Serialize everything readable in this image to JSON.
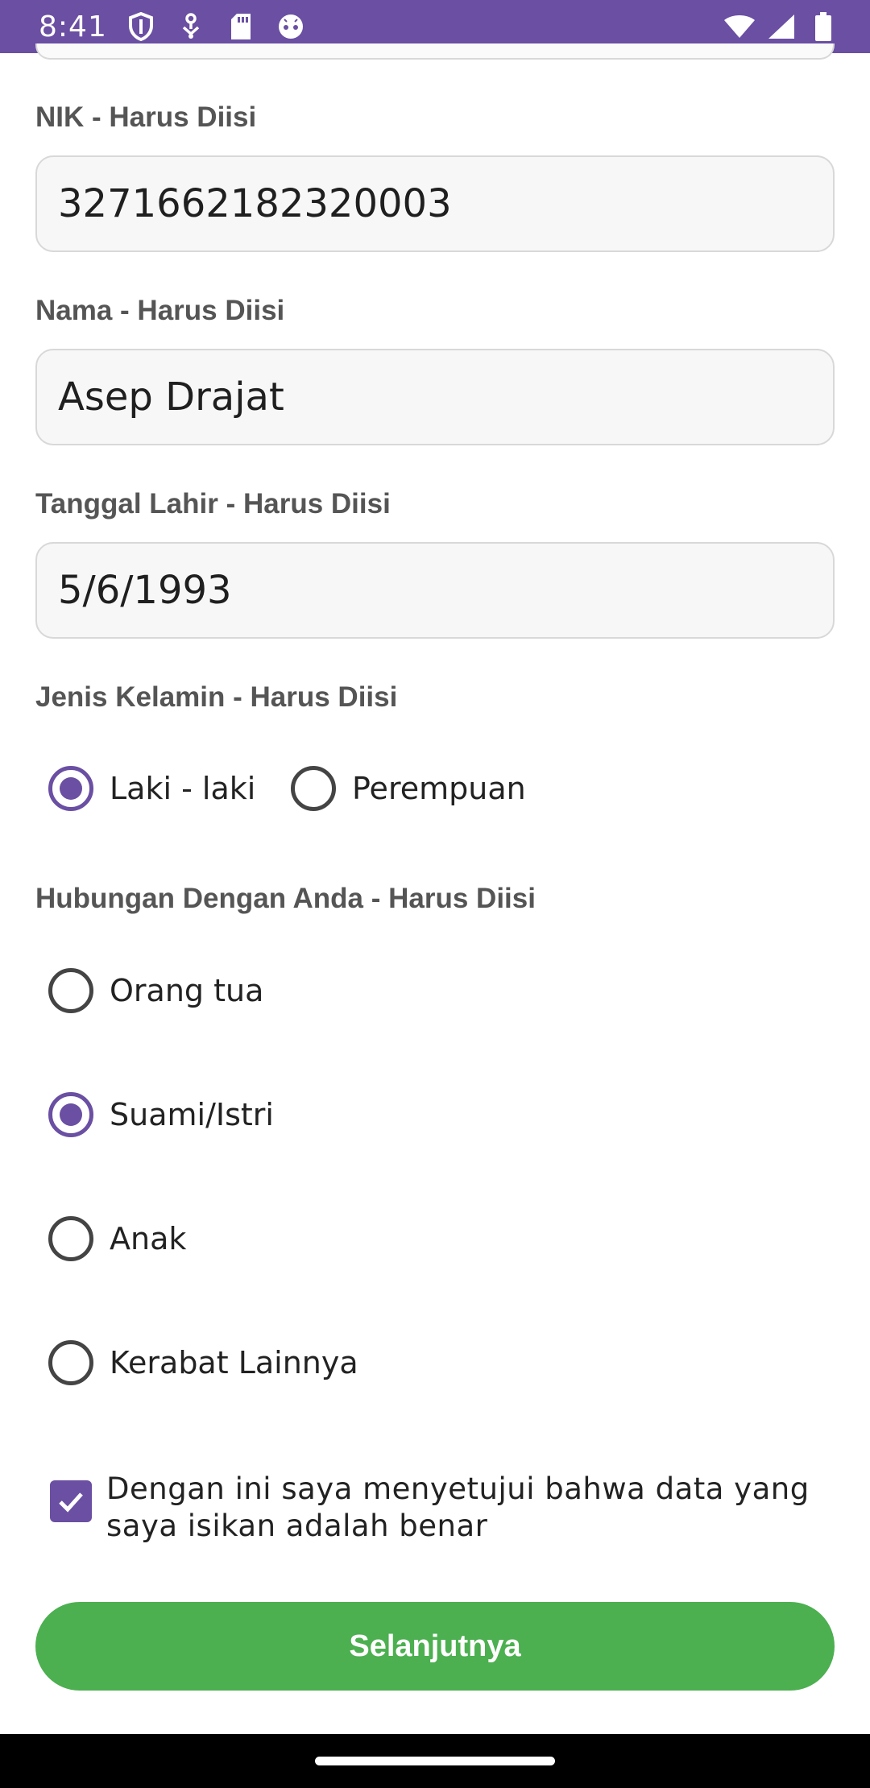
{
  "status_bar": {
    "time": "8:41",
    "left_icons": [
      "shield-icon",
      "usb-debug-icon",
      "sd-card-icon",
      "android-icon"
    ],
    "right_icons": [
      "wifi-icon",
      "signal-icon",
      "battery-icon"
    ],
    "background_color": "#6a4fa3"
  },
  "form": {
    "nik": {
      "label": "NIK - Harus Diisi",
      "value": "3271662182320003"
    },
    "nama": {
      "label": "Nama - Harus Diisi",
      "value": "Asep Drajat"
    },
    "tanggal_lahir": {
      "label": "Tanggal Lahir - Harus Diisi",
      "value": "5/6/1993"
    },
    "jenis_kelamin": {
      "label": "Jenis Kelamin - Harus Diisi",
      "options": [
        "Laki - laki",
        "Perempuan"
      ],
      "selected": "Laki - laki"
    },
    "hubungan": {
      "label": "Hubungan Dengan Anda - Harus Diisi",
      "options": [
        "Orang tua",
        "Suami/Istri",
        "Anak",
        "Kerabat Lainnya"
      ],
      "selected": "Suami/Istri"
    },
    "agreement": {
      "text": "Dengan ini saya menyetujui bahwa data yang saya isikan adalah benar",
      "checked": true
    },
    "next_button": {
      "label": "Selanjutnya"
    }
  },
  "colors": {
    "accent": "#6a4fa3",
    "button": "#4caf50"
  }
}
